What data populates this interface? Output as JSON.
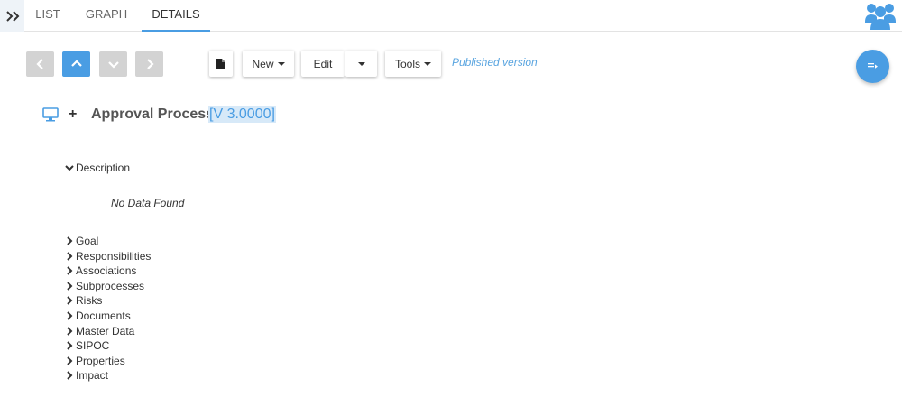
{
  "tabs": {
    "list": "LIST",
    "graph": "GRAPH",
    "details": "DETAILS"
  },
  "toolbar": {
    "new_label": "New",
    "edit_label": "Edit",
    "tools_label": "Tools",
    "status": "Published version"
  },
  "title": {
    "name": "Approval Process",
    "version": "[V 3.0000]"
  },
  "description": {
    "label": "Description",
    "empty_text": "No Data Found"
  },
  "sections": [
    "Goal",
    "Responsibilities",
    "Associations",
    "Subprocesses",
    "Risks",
    "Documents",
    "Master Data",
    "SIPOC",
    "Properties",
    "Impact"
  ],
  "colors": {
    "accent": "#4a9de3",
    "status_text": "#5aa5e0",
    "nav_inactive": "#d3d3d3"
  },
  "icons": {
    "expander": "double-chevron-right-icon",
    "users": "users-group-icon",
    "document": "document-icon",
    "fab": "list-arrow-icon",
    "object": "monitor-icon",
    "expand": "plus-icon"
  }
}
